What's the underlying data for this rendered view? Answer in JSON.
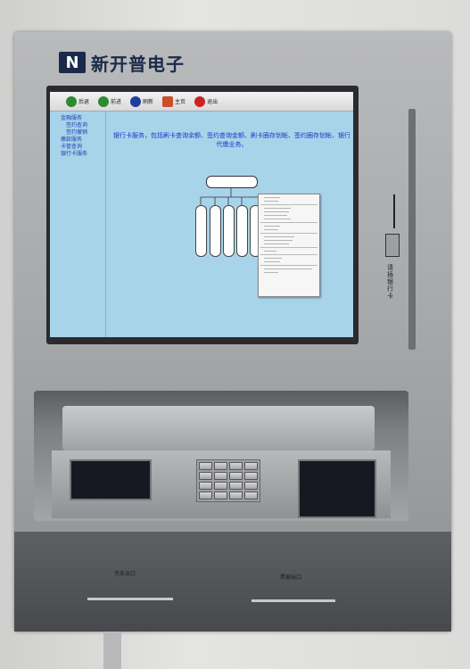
{
  "brand": {
    "logo": "N",
    "name": "新开普电子"
  },
  "toolbar": {
    "items": [
      {
        "label": "后退",
        "icon": "back-arrow-icon",
        "color": "#2e8b2e"
      },
      {
        "label": "前进",
        "icon": "forward-arrow-icon",
        "color": "#2e8b2e"
      },
      {
        "label": "刷新",
        "icon": "refresh-icon",
        "color": "#1f3fa0"
      },
      {
        "label": "主页",
        "icon": "home-icon",
        "color": "#c9502a"
      },
      {
        "label": "退出",
        "icon": "power-icon",
        "color": "#cc2222"
      }
    ]
  },
  "sidebar": {
    "items": [
      {
        "label": "金融服务",
        "sub": false
      },
      {
        "label": "签约查询",
        "sub": true
      },
      {
        "label": "签约撤销",
        "sub": true
      },
      {
        "label": "缴款服务",
        "sub": false
      },
      {
        "label": "卡管查询",
        "sub": false
      },
      {
        "label": "银行卡服务",
        "sub": false
      }
    ]
  },
  "main": {
    "description": "银行卡服务，包括刷卡查询余额、签约查询金额、刷卡圈存划帐、签约圈存划帐、银行代缴业务。"
  },
  "card_label": "请插银行卡",
  "slots": {
    "left_label": "凭条出口",
    "right_label": "票据出口"
  },
  "colors": {
    "screen": "#a8d4ea",
    "link": "#1438c8",
    "brand": "#1b2a4a"
  }
}
